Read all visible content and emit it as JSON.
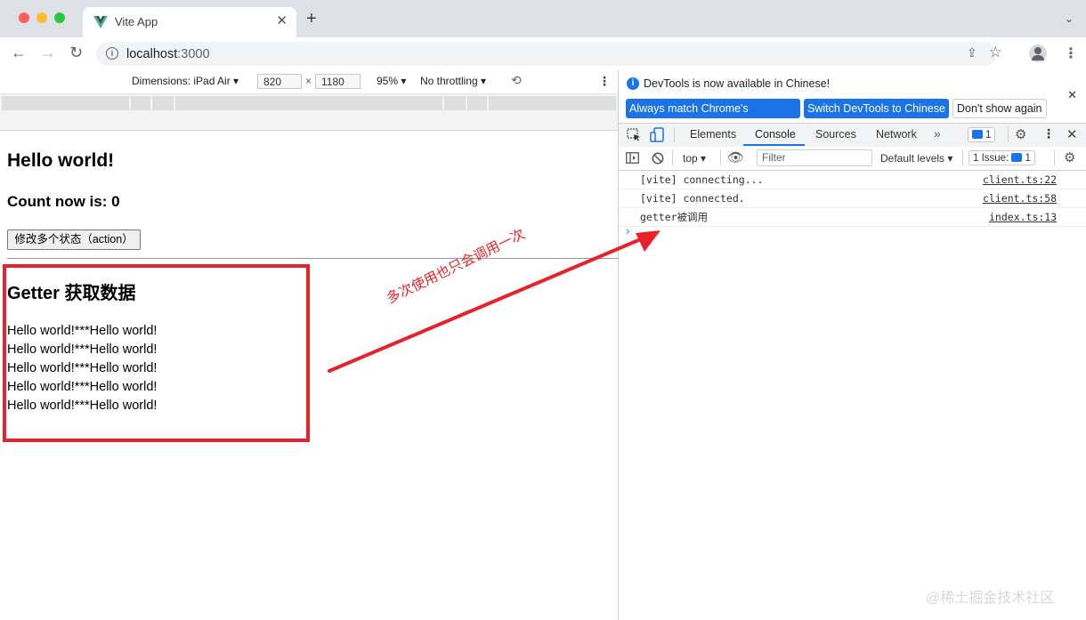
{
  "browser": {
    "tab_title": "Vite App",
    "url_host": "localhost",
    "url_port": ":3000"
  },
  "emulation": {
    "dimensions_label": "Dimensions: iPad Air",
    "width": "820",
    "height": "1180",
    "zoom": "95%",
    "throttling": "No throttling"
  },
  "page": {
    "heading": "Hello world!",
    "count_text": "Count now is: 0",
    "button_label": "修改多个状态（action）",
    "getter_heading": "Getter 获取数据",
    "getter_items": [
      "Hello world!***Hello world!",
      "Hello world!***Hello world!",
      "Hello world!***Hello world!",
      "Hello world!***Hello world!",
      "Hello world!***Hello world!"
    ]
  },
  "annotation": {
    "text": "多次使用也只会调用一次",
    "color": "#e8222a"
  },
  "devtools": {
    "notice_text": "DevTools is now available in Chinese!",
    "notice_buttons": [
      "Always match Chrome's language",
      "Switch DevTools to Chinese",
      "Don't show again"
    ],
    "tabs": [
      "Elements",
      "Console",
      "Sources",
      "Network"
    ],
    "active_tab": "Console",
    "messages_count": "1",
    "console_context": "top",
    "filter_placeholder": "Filter",
    "levels": "Default levels",
    "issues": "1 Issue:",
    "issues_count": "1",
    "logs": [
      {
        "message": "[vite] connecting...",
        "source": "client.ts:22"
      },
      {
        "message": "[vite] connected.",
        "source": "client.ts:58"
      },
      {
        "message": "getter被调用",
        "source": "index.ts:13"
      }
    ],
    "accent": "#1a73e8"
  },
  "watermark": "@稀土掘金技术社区"
}
